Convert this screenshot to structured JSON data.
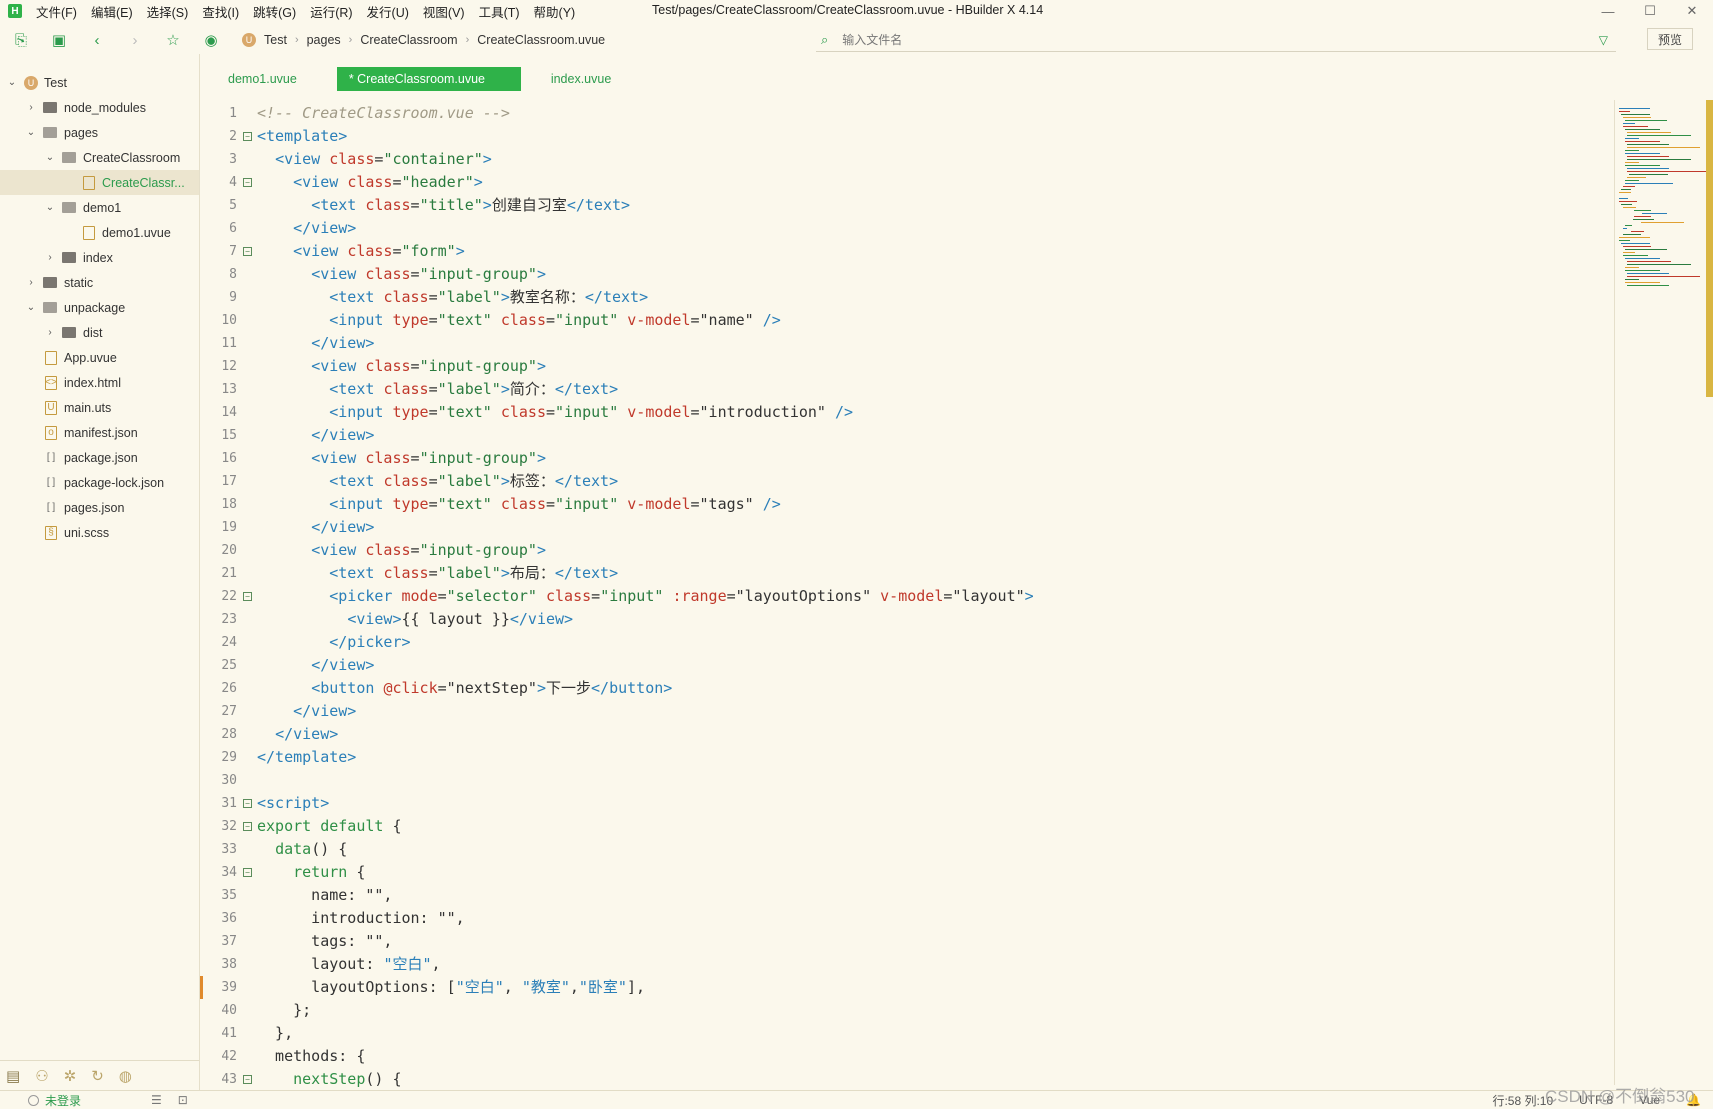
{
  "window": {
    "title": "Test/pages/CreateClassroom/CreateClassroom.uvue - HBuilder X 4.14",
    "logo_text": "H",
    "controls": [
      "—",
      "☐",
      "✕"
    ]
  },
  "menu": [
    "文件(F)",
    "编辑(E)",
    "选择(S)",
    "查找(I)",
    "跳转(G)",
    "运行(R)",
    "发行(U)",
    "视图(V)",
    "工具(T)",
    "帮助(Y)"
  ],
  "toolbar": {
    "breadcrumb": [
      "Test",
      "pages",
      "CreateClassroom",
      "CreateClassroom.uvue"
    ],
    "file_search_placeholder": "输入文件名",
    "preview_label": "预览"
  },
  "tree": [
    {
      "label": "Test",
      "type": "root",
      "depth": 0,
      "expanded": true
    },
    {
      "label": "node_modules",
      "type": "folder",
      "depth": 1,
      "expanded": false
    },
    {
      "label": "pages",
      "type": "folder",
      "depth": 1,
      "expanded": true
    },
    {
      "label": "CreateClassroom",
      "type": "folder",
      "depth": 2,
      "expanded": true
    },
    {
      "label": "CreateClassr...",
      "type": "file",
      "depth": 3,
      "selected": true,
      "icon": "uvue"
    },
    {
      "label": "demo1",
      "type": "folder",
      "depth": 2,
      "expanded": true
    },
    {
      "label": "demo1.uvue",
      "type": "file",
      "depth": 3,
      "icon": "uvue"
    },
    {
      "label": "index",
      "type": "folder",
      "depth": 2,
      "expanded": false
    },
    {
      "label": "static",
      "type": "folder",
      "depth": 1,
      "expanded": false
    },
    {
      "label": "unpackage",
      "type": "folder",
      "depth": 1,
      "expanded": true
    },
    {
      "label": "dist",
      "type": "folder",
      "depth": 2,
      "expanded": false
    },
    {
      "label": "App.uvue",
      "type": "file",
      "depth": 1,
      "icon": "uvue"
    },
    {
      "label": "index.html",
      "type": "file",
      "depth": 1,
      "icon": "html"
    },
    {
      "label": "main.uts",
      "type": "file",
      "depth": 1,
      "icon": "uts"
    },
    {
      "label": "manifest.json",
      "type": "file",
      "depth": 1,
      "icon": "manifest"
    },
    {
      "label": "package.json",
      "type": "file",
      "depth": 1,
      "icon": "json"
    },
    {
      "label": "package-lock.json",
      "type": "file",
      "depth": 1,
      "icon": "json"
    },
    {
      "label": "pages.json",
      "type": "file",
      "depth": 1,
      "icon": "json"
    },
    {
      "label": "uni.scss",
      "type": "file",
      "depth": 1,
      "icon": "scss"
    }
  ],
  "tabs": [
    {
      "label": "demo1.uvue",
      "active": false
    },
    {
      "label": "* CreateClassroom.uvue",
      "active": true
    },
    {
      "label": "index.uvue",
      "active": false
    }
  ],
  "code_lines": [
    [
      [
        "c",
        "<!-- CreateClassroom.vue -->"
      ]
    ],
    [
      [
        "t",
        "<template>"
      ]
    ],
    [
      [
        "p",
        "  "
      ],
      [
        "t",
        "<view "
      ],
      [
        "a",
        "class"
      ],
      [
        "p",
        "="
      ],
      [
        "s",
        "\"container\""
      ],
      [
        "t",
        ">"
      ]
    ],
    [
      [
        "p",
        "    "
      ],
      [
        "t",
        "<view "
      ],
      [
        "a",
        "class"
      ],
      [
        "p",
        "="
      ],
      [
        "s",
        "\"header\""
      ],
      [
        "t",
        ">"
      ]
    ],
    [
      [
        "p",
        "      "
      ],
      [
        "t",
        "<text "
      ],
      [
        "a",
        "class"
      ],
      [
        "p",
        "="
      ],
      [
        "s",
        "\"title\""
      ],
      [
        "t",
        ">"
      ],
      [
        "p",
        "创建自习室"
      ],
      [
        "t",
        "</text>"
      ]
    ],
    [
      [
        "p",
        "    "
      ],
      [
        "t",
        "</view>"
      ]
    ],
    [
      [
        "p",
        "    "
      ],
      [
        "t",
        "<view "
      ],
      [
        "a",
        "class"
      ],
      [
        "p",
        "="
      ],
      [
        "s",
        "\"form\""
      ],
      [
        "t",
        ">"
      ]
    ],
    [
      [
        "p",
        "      "
      ],
      [
        "t",
        "<view "
      ],
      [
        "a",
        "class"
      ],
      [
        "p",
        "="
      ],
      [
        "s",
        "\"input-group\""
      ],
      [
        "t",
        ">"
      ]
    ],
    [
      [
        "p",
        "        "
      ],
      [
        "t",
        "<text "
      ],
      [
        "a",
        "class"
      ],
      [
        "p",
        "="
      ],
      [
        "s",
        "\"label\""
      ],
      [
        "t",
        ">"
      ],
      [
        "p",
        "教室名称："
      ],
      [
        "t",
        "</text>"
      ]
    ],
    [
      [
        "p",
        "        "
      ],
      [
        "t",
        "<input "
      ],
      [
        "a",
        "type"
      ],
      [
        "p",
        "="
      ],
      [
        "s",
        "\"text\" "
      ],
      [
        "a",
        "class"
      ],
      [
        "p",
        "="
      ],
      [
        "s",
        "\"input\" "
      ],
      [
        "a",
        "v-model"
      ],
      [
        "p",
        "=\"name\" "
      ],
      [
        "t",
        "/>"
      ]
    ],
    [
      [
        "p",
        "      "
      ],
      [
        "t",
        "</view>"
      ]
    ],
    [
      [
        "p",
        "      "
      ],
      [
        "t",
        "<view "
      ],
      [
        "a",
        "class"
      ],
      [
        "p",
        "="
      ],
      [
        "s",
        "\"input-group\""
      ],
      [
        "t",
        ">"
      ]
    ],
    [
      [
        "p",
        "        "
      ],
      [
        "t",
        "<text "
      ],
      [
        "a",
        "class"
      ],
      [
        "p",
        "="
      ],
      [
        "s",
        "\"label\""
      ],
      [
        "t",
        ">"
      ],
      [
        "p",
        "简介："
      ],
      [
        "t",
        "</text>"
      ]
    ],
    [
      [
        "p",
        "        "
      ],
      [
        "t",
        "<input "
      ],
      [
        "a",
        "type"
      ],
      [
        "p",
        "="
      ],
      [
        "s",
        "\"text\" "
      ],
      [
        "a",
        "class"
      ],
      [
        "p",
        "="
      ],
      [
        "s",
        "\"input\" "
      ],
      [
        "a",
        "v-model"
      ],
      [
        "p",
        "=\"introduction\" "
      ],
      [
        "t",
        "/>"
      ]
    ],
    [
      [
        "p",
        "      "
      ],
      [
        "t",
        "</view>"
      ]
    ],
    [
      [
        "p",
        "      "
      ],
      [
        "t",
        "<view "
      ],
      [
        "a",
        "class"
      ],
      [
        "p",
        "="
      ],
      [
        "s",
        "\"input-group\""
      ],
      [
        "t",
        ">"
      ]
    ],
    [
      [
        "p",
        "        "
      ],
      [
        "t",
        "<text "
      ],
      [
        "a",
        "class"
      ],
      [
        "p",
        "="
      ],
      [
        "s",
        "\"label\""
      ],
      [
        "t",
        ">"
      ],
      [
        "p",
        "标签："
      ],
      [
        "t",
        "</text>"
      ]
    ],
    [
      [
        "p",
        "        "
      ],
      [
        "t",
        "<input "
      ],
      [
        "a",
        "type"
      ],
      [
        "p",
        "="
      ],
      [
        "s",
        "\"text\" "
      ],
      [
        "a",
        "class"
      ],
      [
        "p",
        "="
      ],
      [
        "s",
        "\"input\" "
      ],
      [
        "a",
        "v-model"
      ],
      [
        "p",
        "=\"tags\" "
      ],
      [
        "t",
        "/>"
      ]
    ],
    [
      [
        "p",
        "      "
      ],
      [
        "t",
        "</view>"
      ]
    ],
    [
      [
        "p",
        "      "
      ],
      [
        "t",
        "<view "
      ],
      [
        "a",
        "class"
      ],
      [
        "p",
        "="
      ],
      [
        "s",
        "\"input-group\""
      ],
      [
        "t",
        ">"
      ]
    ],
    [
      [
        "p",
        "        "
      ],
      [
        "t",
        "<text "
      ],
      [
        "a",
        "class"
      ],
      [
        "p",
        "="
      ],
      [
        "s",
        "\"label\""
      ],
      [
        "t",
        ">"
      ],
      [
        "p",
        "布局："
      ],
      [
        "t",
        "</text>"
      ]
    ],
    [
      [
        "p",
        "        "
      ],
      [
        "t",
        "<picker "
      ],
      [
        "a",
        "mode"
      ],
      [
        "p",
        "="
      ],
      [
        "s",
        "\"selector\" "
      ],
      [
        "a",
        "class"
      ],
      [
        "p",
        "="
      ],
      [
        "s",
        "\"input\" "
      ],
      [
        "a",
        ":range"
      ],
      [
        "p",
        "=\"layoutOptions\" "
      ],
      [
        "a",
        "v-model"
      ],
      [
        "p",
        "=\"layout\""
      ],
      [
        "t",
        ">"
      ]
    ],
    [
      [
        "p",
        "          "
      ],
      [
        "t",
        "<view>"
      ],
      [
        "p",
        "{{ layout }}"
      ],
      [
        "t",
        "</view>"
      ]
    ],
    [
      [
        "p",
        "        "
      ],
      [
        "t",
        "</picker>"
      ]
    ],
    [
      [
        "p",
        "      "
      ],
      [
        "t",
        "</view>"
      ]
    ],
    [
      [
        "p",
        "      "
      ],
      [
        "t",
        "<button "
      ],
      [
        "a",
        "@click"
      ],
      [
        "p",
        "=\"nextStep\""
      ],
      [
        "t",
        ">"
      ],
      [
        "p",
        "下一步"
      ],
      [
        "t",
        "</button>"
      ]
    ],
    [
      [
        "p",
        "    "
      ],
      [
        "t",
        "</view>"
      ]
    ],
    [
      [
        "p",
        "  "
      ],
      [
        "t",
        "</view>"
      ]
    ],
    [
      [
        "t",
        "</template>"
      ]
    ],
    [],
    [
      [
        "t",
        "<script>"
      ]
    ],
    [
      [
        "k",
        "export default "
      ],
      [
        "p",
        "{"
      ]
    ],
    [
      [
        "p",
        "  "
      ],
      [
        "k",
        "data"
      ],
      [
        "p",
        "() {"
      ]
    ],
    [
      [
        "p",
        "    "
      ],
      [
        "k",
        "return "
      ],
      [
        "p",
        "{"
      ]
    ],
    [
      [
        "p",
        "      name: \"\","
      ]
    ],
    [
      [
        "p",
        "      introduction: \"\","
      ]
    ],
    [
      [
        "p",
        "      tags: \"\","
      ]
    ],
    [
      [
        "p",
        "      layout: "
      ],
      [
        "z",
        "\"空白\""
      ],
      [
        "p",
        ","
      ]
    ],
    [
      [
        "p",
        "      layoutOptions: ["
      ],
      [
        "z",
        "\"空白\""
      ],
      [
        "p",
        ", "
      ],
      [
        "z",
        "\"教室\""
      ],
      [
        "p",
        ","
      ],
      [
        "z",
        "\"卧室\""
      ],
      [
        "p",
        "],"
      ]
    ],
    [
      [
        "p",
        "    };"
      ]
    ],
    [
      [
        "p",
        "  },"
      ]
    ],
    [
      [
        "p",
        "  methods: {"
      ]
    ],
    [
      [
        "p",
        "    "
      ],
      [
        "k",
        "nextStep"
      ],
      [
        "p",
        "() {"
      ]
    ]
  ],
  "fold_lines": [
    2,
    4,
    7,
    22,
    31,
    32,
    34,
    43
  ],
  "modified_lines": [
    39
  ],
  "status": {
    "login": "未登录",
    "position": "行:58  列:10",
    "encoding": "UTF-8",
    "language": "Vue"
  },
  "watermark": "CSDN @不倒翁530",
  "colors": {
    "accent": "#2fb249",
    "background": "#fbf8ec",
    "tag": "#2b7fb8",
    "attr": "#c0392b",
    "string": "#2a7b3f"
  }
}
